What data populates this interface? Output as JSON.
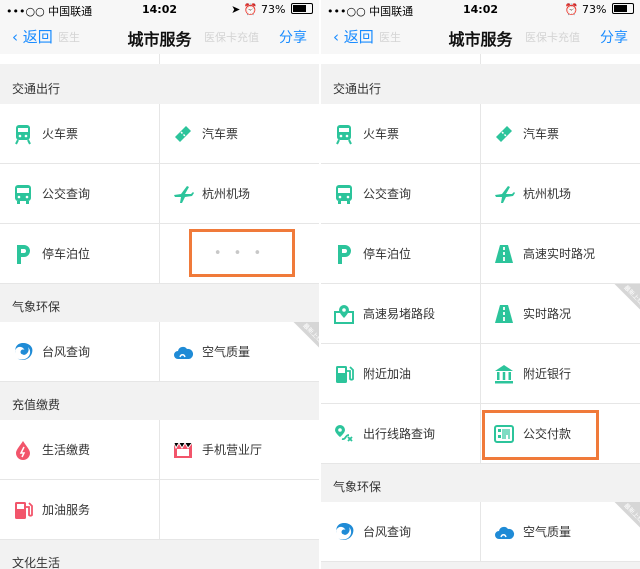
{
  "status": {
    "carrier": "•••○○ 中国联通",
    "time": "14:02",
    "battery": "73%"
  },
  "nav": {
    "back": "返回",
    "ghost_left": "医生",
    "title": "城市服务",
    "ghost_right": "医保卡充值",
    "share": "分享"
  },
  "badge": "最新上线",
  "left": {
    "sections": [
      {
        "title": "交通出行",
        "items": [
          "火车票",
          "汽车票",
          "公交查询",
          "杭州机场",
          "停车泊位",
          "• • •"
        ]
      },
      {
        "title": "气象环保",
        "items": [
          "台风查询",
          "空气质量"
        ]
      },
      {
        "title": "充值缴费",
        "items": [
          "生活缴费",
          "手机营业厅",
          "加油服务"
        ]
      },
      {
        "title": "文化生活"
      }
    ]
  },
  "right": {
    "sections": [
      {
        "title": "交通出行",
        "items": [
          "火车票",
          "汽车票",
          "公交查询",
          "杭州机场",
          "停车泊位",
          "高速实时路况",
          "高速易堵路段",
          "实时路况",
          "附近加油",
          "附近银行",
          "出行线路查询",
          "公交付款"
        ]
      },
      {
        "title": "气象环保",
        "items": [
          "台风查询",
          "空气质量"
        ]
      }
    ]
  },
  "colors": {
    "accent": "#1a8cff",
    "icon": "#2cc49b",
    "highlight": "#f07a3a",
    "typhoon": "#1f8bd6",
    "red": "#f2556b"
  }
}
